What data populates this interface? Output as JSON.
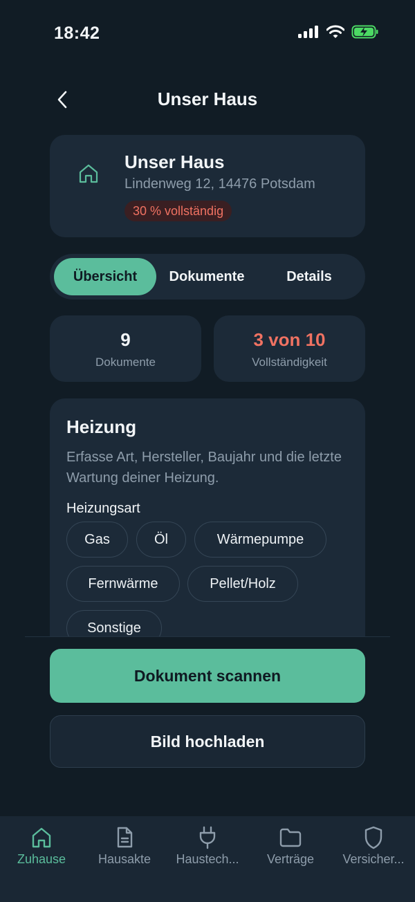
{
  "status_bar": {
    "time": "18:42"
  },
  "nav": {
    "title": "Unser Haus"
  },
  "house": {
    "name": "Unser Haus",
    "address": "Lindenweg 12, 14476 Potsdam",
    "completeness_badge": "30 % vollständig"
  },
  "segments": [
    {
      "label": "Übersicht",
      "active": true
    },
    {
      "label": "Dokumente",
      "active": false
    },
    {
      "label": "Details",
      "active": false
    }
  ],
  "stats": [
    {
      "value": "9",
      "label": "Dokumente"
    },
    {
      "value": "3 von 10",
      "label": "Vollständigkeit"
    }
  ],
  "heating": {
    "title": "Heizung",
    "description": "Erfasse Art, Hersteller, Baujahr und die letzte Wartung deiner Heizung.",
    "type_label": "Heizungsart",
    "options": [
      "Gas",
      "Öl",
      "Wärmepumpe",
      "Fernwärme",
      "Pellet/Holz",
      "Sonstige"
    ]
  },
  "actions": {
    "scan": "Dokument scannen",
    "upload": "Bild hochladen"
  },
  "tabs": [
    {
      "label": "Zuhause",
      "icon": "home-icon",
      "active": true
    },
    {
      "label": "Hausakte",
      "icon": "document-icon",
      "active": false
    },
    {
      "label": "Haustech...",
      "icon": "plug-icon",
      "active": false
    },
    {
      "label": "Verträge",
      "icon": "folder-icon",
      "active": false
    },
    {
      "label": "Versicher...",
      "icon": "shield-icon",
      "active": false
    }
  ],
  "colors": {
    "background": "#111c25",
    "card": "#1c2a38",
    "accent": "#5bbd9c",
    "warning": "#f07262",
    "muted_text": "#8e9dab"
  }
}
